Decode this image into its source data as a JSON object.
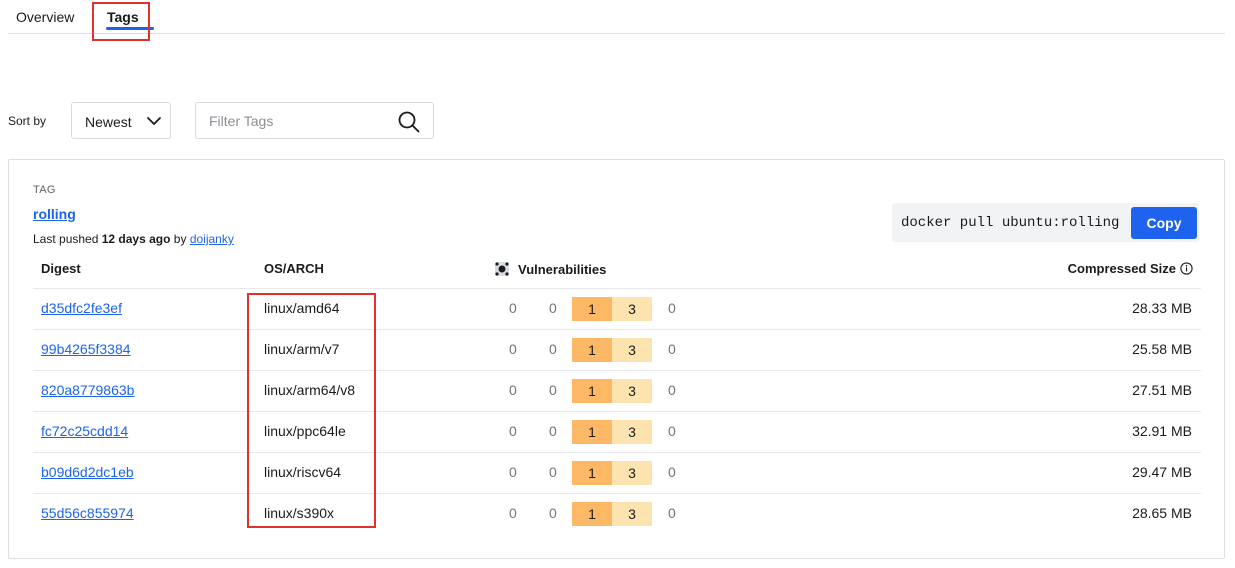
{
  "tabs": [
    {
      "label": "Overview",
      "active": false
    },
    {
      "label": "Tags",
      "active": true
    }
  ],
  "controls": {
    "sort_label": "Sort by",
    "sort_value": "Newest",
    "filter_placeholder": "Filter Tags"
  },
  "tag": {
    "section_label": "TAG",
    "name": "rolling",
    "pushed_prefix": "Last pushed",
    "pushed_time": "12 days ago",
    "pushed_by": "by",
    "pushed_user": "doijanky",
    "pull_command": "docker pull ubuntu:rolling",
    "copy_label": "Copy"
  },
  "table": {
    "headers": {
      "digest": "Digest",
      "os_arch": "OS/ARCH",
      "vulnerabilities": "Vulnerabilities",
      "size": "Compressed Size"
    },
    "rows": [
      {
        "digest": "d35dfc2fe3ef",
        "os_arch": "linux/amd64",
        "v": [
          "0",
          "0",
          "1",
          "3",
          "0"
        ],
        "size": "28.33 MB"
      },
      {
        "digest": "99b4265f3384",
        "os_arch": "linux/arm/v7",
        "v": [
          "0",
          "0",
          "1",
          "3",
          "0"
        ],
        "size": "25.58 MB"
      },
      {
        "digest": "820a8779863b",
        "os_arch": "linux/arm64/v8",
        "v": [
          "0",
          "0",
          "1",
          "3",
          "0"
        ],
        "size": "27.51 MB"
      },
      {
        "digest": "fc72c25cdd14",
        "os_arch": "linux/ppc64le",
        "v": [
          "0",
          "0",
          "1",
          "3",
          "0"
        ],
        "size": "32.91 MB"
      },
      {
        "digest": "b09d6d2dc1eb",
        "os_arch": "linux/riscv64",
        "v": [
          "0",
          "0",
          "1",
          "3",
          "0"
        ],
        "size": "29.47 MB"
      },
      {
        "digest": "55d56c855974",
        "os_arch": "linux/s390x",
        "v": [
          "0",
          "0",
          "1",
          "3",
          "0"
        ],
        "size": "28.65 MB"
      }
    ]
  },
  "colors": {
    "accent": "#1d63ed",
    "highlight_box": "#e0322d",
    "vuln_medium": "#fcb865",
    "vuln_low": "#fde3b0"
  },
  "icons": {
    "sort": "chevron-down-icon",
    "filter": "search-icon",
    "vulnerabilities": "scout-icon",
    "size": "info-icon"
  }
}
